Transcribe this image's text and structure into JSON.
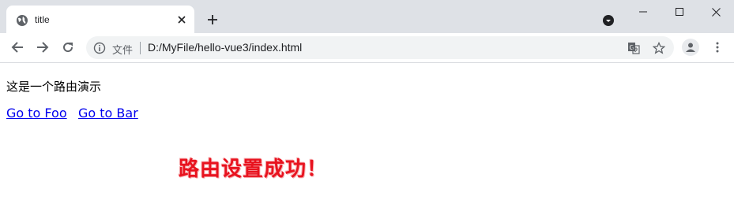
{
  "browser": {
    "tab": {
      "title": "title",
      "favicon": "globe-icon"
    },
    "security_label": "文件",
    "url": "D:/MyFile/hello-vue3/index.html"
  },
  "page": {
    "intro": "这是一个路由演示",
    "links": [
      {
        "label": "Go to Foo"
      },
      {
        "label": "Go to Bar"
      }
    ],
    "annotation": "路由设置成功！"
  },
  "colors": {
    "link": "#0000ee",
    "annotation": "#e8131f",
    "tabstrip": "#dee1e6",
    "omnibox": "#f1f3f4"
  }
}
